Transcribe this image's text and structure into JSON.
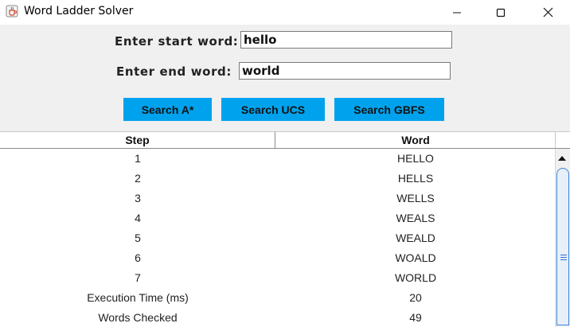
{
  "window": {
    "title": "Word Ladder Solver"
  },
  "form": {
    "start_label": "Enter start word:",
    "start_value": "hello",
    "end_label": "Enter end word:",
    "end_value": "world"
  },
  "buttons": {
    "astar": "Search A*",
    "ucs": "Search UCS",
    "gbfs": "Search GBFS"
  },
  "table": {
    "headers": [
      "Step",
      "Word"
    ],
    "rows": [
      [
        "1",
        "HELLO"
      ],
      [
        "2",
        "HELLS"
      ],
      [
        "3",
        "WELLS"
      ],
      [
        "4",
        "WEALS"
      ],
      [
        "5",
        "WEALD"
      ],
      [
        "6",
        "WOALD"
      ],
      [
        "7",
        "WORLD"
      ],
      [
        "Execution Time (ms)",
        "20"
      ],
      [
        "Words Checked",
        "49"
      ]
    ]
  },
  "colors": {
    "button_bg": "#00a2ed",
    "scroll_thumb_border": "#3a86d8"
  },
  "icons": [
    "java-app-icon",
    "minimize-icon",
    "maximize-icon",
    "close-icon",
    "scroll-up-arrow-icon"
  ]
}
